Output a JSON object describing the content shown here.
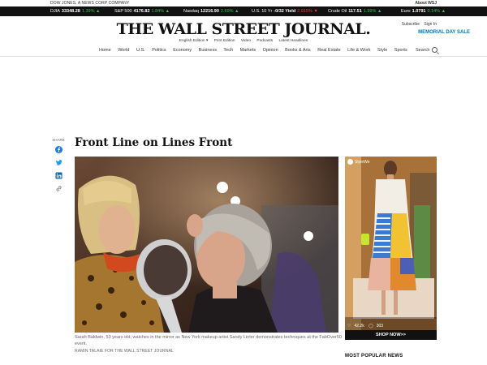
{
  "corp_bar": {
    "left": "DOW JONES, A NEWS CORP COMPANY",
    "right": "About WSJ"
  },
  "ticker": [
    {
      "name": "DJIA",
      "value": "33348.28",
      "change": "1.39%",
      "dir": "up"
    },
    {
      "name": "S&P 500",
      "value": "4176.82",
      "change": "1.84%",
      "dir": "up"
    },
    {
      "name": "Nasdaq",
      "value": "12216.90",
      "change": "2.69%",
      "dir": "up"
    },
    {
      "name": "U.S. 10 Yr",
      "value": "-0/32 Yield",
      "change": "2.915%",
      "dir": "dn"
    },
    {
      "name": "Crude Oil",
      "value": "117.51",
      "change": "1.99%",
      "dir": "up"
    },
    {
      "name": "Euro",
      "value": "1.0791",
      "change": "0.14%",
      "dir": "up"
    }
  ],
  "header": {
    "masthead": "THE WALL STREET JOURNAL.",
    "sub_links": [
      "English Edition ▾",
      "Print Edition",
      "Video",
      "Podcasts",
      "Latest Headlines"
    ],
    "subscribe": "Subscribe",
    "signin": "Sign In",
    "sale": "MEMORIAL DAY SALE"
  },
  "nav": {
    "items": [
      "Home",
      "World",
      "U.S.",
      "Politics",
      "Economy",
      "Business",
      "Tech",
      "Markets",
      "Opinion",
      "Books & Arts",
      "Real Estate",
      "Life & Work",
      "Style",
      "Sports"
    ],
    "search": "Search"
  },
  "share": {
    "label": "SHARE"
  },
  "article": {
    "headline": "Front Line on Lines Front",
    "caption": "Sarah Baldwin, 53 years old, watches in the mirror as New York makeup artist Sandy Linter demonstrates techniques at the FabOver50 event.",
    "credit": "RAMIN TALAIE FOR THE WALL STREET JOURNAL"
  },
  "ad": {
    "brand": "StyleWe",
    "likes": "42.2k",
    "comments": "303",
    "cta": "SHOP NOW>>"
  },
  "sidebar": {
    "most_popular": "MOST POPULAR NEWS"
  }
}
